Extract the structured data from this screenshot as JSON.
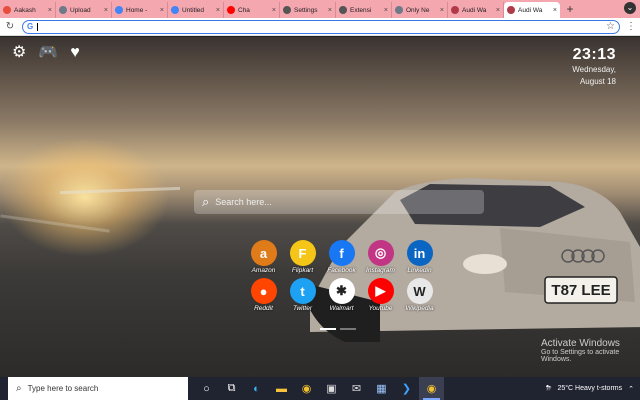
{
  "browser": {
    "tabs": [
      {
        "title": "Aakash",
        "color": "#e74c3c"
      },
      {
        "title": "Upload",
        "color": "#6c7a89"
      },
      {
        "title": "Home -",
        "color": "#4285f4"
      },
      {
        "title": "Untitled",
        "color": "#4285f4"
      },
      {
        "title": "Cha",
        "color": "#ff0000"
      },
      {
        "title": "Settings",
        "color": "#555555"
      },
      {
        "title": "Extensi",
        "color": "#555555"
      },
      {
        "title": "Only Ne",
        "color": "#6c7a89"
      },
      {
        "title": "Audi Wa",
        "color": "#b03a48"
      },
      {
        "title": "Audi Wa",
        "color": "#b03a48",
        "active": true
      }
    ],
    "new_tab": "+",
    "address": ""
  },
  "newtab": {
    "time": "23:13",
    "weekday": "Wednesday,",
    "date": "August 18",
    "search_placeholder": "Search here...",
    "shortcuts": [
      {
        "label": "Amazon",
        "icon": "amazon-icon",
        "glyph": "a",
        "color": "#e07b1a"
      },
      {
        "label": "Flipkart",
        "icon": "flipkart-icon",
        "glyph": "F",
        "color": "#f5c518"
      },
      {
        "label": "Facebook",
        "icon": "facebook-icon",
        "glyph": "f",
        "color": "#1877f2"
      },
      {
        "label": "Instagram",
        "icon": "instagram-icon",
        "glyph": "◎",
        "color": "#c13584"
      },
      {
        "label": "Linkedin",
        "icon": "linkedin-icon",
        "glyph": "in",
        "color": "#0a66c2"
      },
      {
        "label": "Reddit",
        "icon": "reddit-icon",
        "glyph": "●",
        "color": "#ff4500"
      },
      {
        "label": "Twitter",
        "icon": "twitter-icon",
        "glyph": "t",
        "color": "#1da1f2"
      },
      {
        "label": "Walmart",
        "icon": "walmart-icon",
        "glyph": "✱",
        "color": "#ffffff"
      },
      {
        "label": "Youtube",
        "icon": "youtube-icon",
        "glyph": "▶",
        "color": "#ff0000"
      },
      {
        "label": "Wikipedia",
        "icon": "wikipedia-icon",
        "glyph": "W",
        "color": "#e8e8e8"
      }
    ],
    "plate_text": "T87 LEE"
  },
  "activate": {
    "title": "Activate Windows",
    "subtitle": "Go to Settings to activate Windows."
  },
  "taskbar": {
    "search_text": "Type here to search",
    "weather": "25°C  Heavy t-storms"
  }
}
